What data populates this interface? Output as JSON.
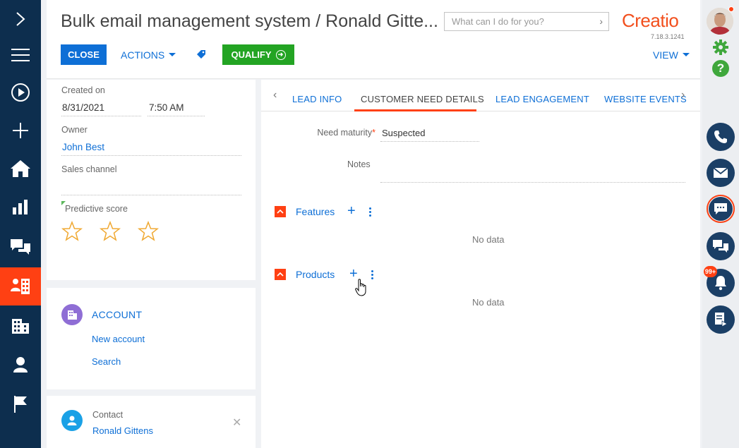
{
  "header": {
    "title": "Bulk email management system / Ronald Gitte...",
    "search_placeholder": "What can I do for you?",
    "logo": "Creatio",
    "version": "7.18.3.1241",
    "close_label": "CLOSE",
    "actions_label": "ACTIONS",
    "qualify_label": "QUALIFY",
    "view_label": "VIEW"
  },
  "profile": {
    "created_on_label": "Created on",
    "created_date": "8/31/2021",
    "created_time": "7:50 AM",
    "owner_label": "Owner",
    "owner_value": "John Best",
    "sales_channel_label": "Sales channel",
    "sales_channel_value": "",
    "predictive_score_label": "Predictive score",
    "stars_filled": 0,
    "stars_total": 3
  },
  "account": {
    "title": "ACCOUNT",
    "new_account": "New account",
    "search": "Search"
  },
  "contact": {
    "label": "Contact",
    "name": "Ronald Gittens"
  },
  "tabs": {
    "items": [
      "LEAD INFO",
      "CUSTOMER NEED DETAILS",
      "LEAD ENGAGEMENT",
      "WEBSITE EVENTS"
    ],
    "active": "CUSTOMER NEED DETAILS"
  },
  "details": {
    "need_maturity_label": "Need maturity",
    "need_maturity_value": "Suspected",
    "notes_label": "Notes",
    "notes_value": ""
  },
  "sections": {
    "features_title": "Features",
    "features_empty": "No data",
    "products_title": "Products",
    "products_empty": "No data"
  },
  "notifications": {
    "badge": "99+"
  },
  "colors": {
    "accent": "#ff4013",
    "primary_blue": "#0e6fd6",
    "qualify_green": "#23a423",
    "sidebar_dark": "#0d2e4e"
  }
}
